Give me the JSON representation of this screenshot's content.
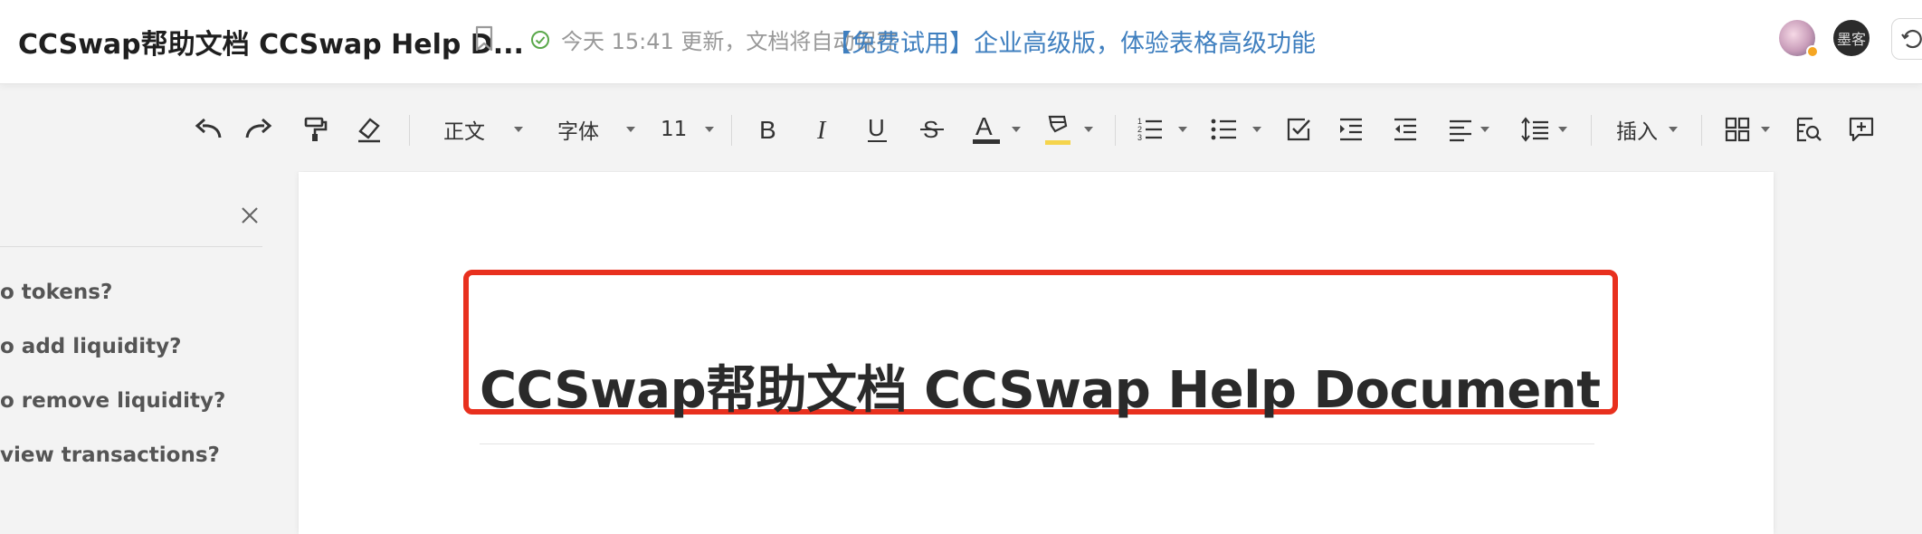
{
  "header": {
    "doc_title": "CCSwap帮助文档 CCSwap Help D...",
    "status_text": "今天 15:41 更新，文档将自动保存",
    "promo_text": "【免费试用】企业高级版，体验表格高级功能",
    "avatar2_text": "墨客"
  },
  "toolbar": {
    "paragraph_style": "正文",
    "font_family": "字体",
    "font_size": "11",
    "insert_label": "插入",
    "font_color": "#333333",
    "highlight_color": "#f5d44c"
  },
  "sidebar": {
    "items": [
      "o tokens?",
      "o add liquidity?",
      "o remove liquidity?",
      "view transactions?"
    ]
  },
  "document": {
    "heading": "CCSwap帮助文档 CCSwap Help Document"
  },
  "colors": {
    "accent_link": "#3f7fbf",
    "annotation_red": "#e8301e"
  }
}
